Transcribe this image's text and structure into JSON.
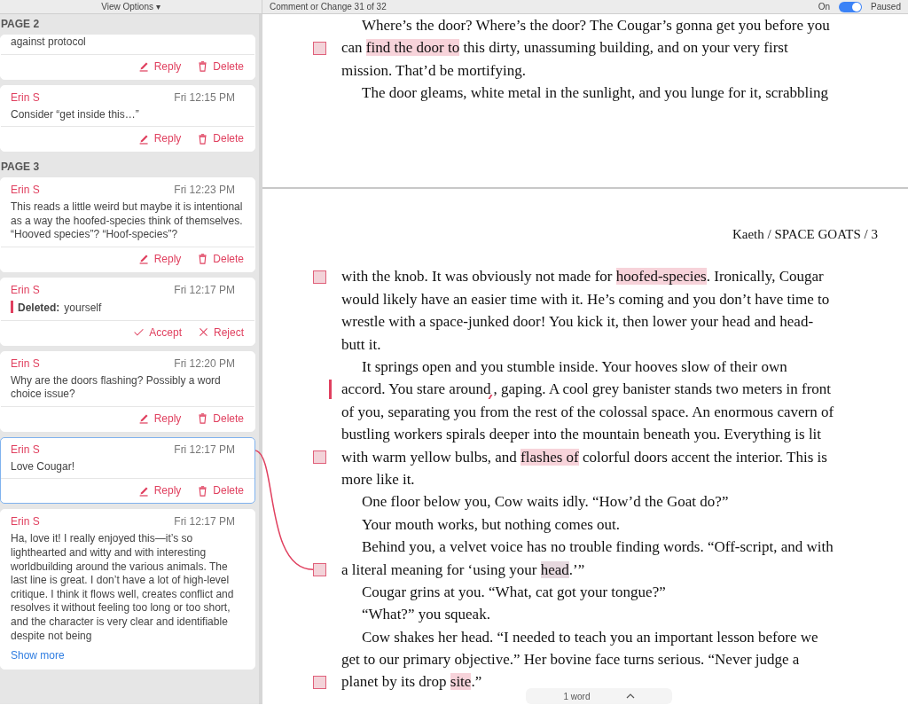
{
  "toolbar": {
    "view_options": "View Options ▾",
    "navigator": "Comment or Change 31 of 32",
    "tracking": {
      "label": "On",
      "on": true
    },
    "status": "Paused"
  },
  "sidebar": {
    "groups": [
      {
        "page": "PAGE 2",
        "cards": [
          {
            "kind": "partial",
            "body": "against protocol",
            "selected": false,
            "actions": [
              {
                "kind": "reply",
                "label": "Reply"
              },
              {
                "kind": "delete",
                "label": "Delete"
              }
            ]
          },
          {
            "kind": "comment",
            "author": "Erin S",
            "time": "Fri 12:15 PM",
            "body": "Consider “get inside this…”",
            "selected": false,
            "actions": [
              {
                "kind": "reply",
                "label": "Reply"
              },
              {
                "kind": "delete",
                "label": "Delete"
              }
            ]
          }
        ]
      },
      {
        "page": "PAGE 3",
        "cards": [
          {
            "kind": "comment",
            "author": "Erin S",
            "time": "Fri 12:23 PM",
            "body": "This reads a little weird but maybe it is intentional as a way the hoofed-species think of themselves. “Hooved species”? “Hoof-species”?",
            "selected": false,
            "actions": [
              {
                "kind": "reply",
                "label": "Reply"
              },
              {
                "kind": "delete",
                "label": "Delete"
              }
            ]
          },
          {
            "kind": "deletion",
            "author": "Erin S",
            "time": "Fri 12:17 PM",
            "change_label": "Deleted:",
            "body": "yourself",
            "selected": false,
            "actions": [
              {
                "kind": "accept",
                "label": "Accept"
              },
              {
                "kind": "reject",
                "label": "Reject"
              }
            ]
          },
          {
            "kind": "comment",
            "author": "Erin S",
            "time": "Fri 12:20 PM",
            "body": "Why are the doors flashing? Possibly a word choice issue?",
            "selected": false,
            "actions": [
              {
                "kind": "reply",
                "label": "Reply"
              },
              {
                "kind": "delete",
                "label": "Delete"
              }
            ]
          },
          {
            "kind": "comment",
            "author": "Erin S",
            "time": "Fri 12:17 PM",
            "body": "Love Cougar!",
            "selected": true,
            "actions": [
              {
                "kind": "reply",
                "label": "Reply"
              },
              {
                "kind": "delete",
                "label": "Delete"
              }
            ]
          },
          {
            "kind": "comment",
            "author": "Erin S",
            "time": "Fri 12:17 PM",
            "body": "Ha, love it! I really enjoyed this—it’s so lighthearted and witty and with interesting worldbuilding around the various animals. The last line is great. I don’t have a lot of high-level critique. I think it flows well, creates conflict and resolves it without feeling too long or too short, and the character is very clear and identifiable despite not being",
            "show_more": "Show more",
            "selected": false
          }
        ]
      }
    ]
  },
  "document": {
    "pages": [
      {
        "lines": [
          {
            "indent": true,
            "segments": [
              {
                "text": "Where’s the door? Where’s the door? The Cougar’s gonna get you before you"
              }
            ]
          },
          {
            "indent": false,
            "comment_marker": true,
            "segments": [
              {
                "text": "can "
              },
              {
                "text": "find the door to",
                "highlighted": true
              },
              {
                "text": " this dirty, unassuming building, and on your very first"
              }
            ]
          },
          {
            "indent": false,
            "segments": [
              {
                "text": "mission. That’d be mortifying."
              }
            ]
          },
          {
            "indent": true,
            "segments": [
              {
                "text": "The door gleams, white metal in the sunlight, and you lunge for it, scrabbling"
              }
            ]
          }
        ]
      },
      {
        "header": "Kaeth / SPACE GOATS / 3",
        "lines": [
          {
            "indent": false,
            "comment_marker": true,
            "segments": [
              {
                "text": "with the knob. It was obviously not made for "
              },
              {
                "text": "hoofed-species",
                "highlighted": true
              },
              {
                "text": ". Ironically, Cougar"
              }
            ]
          },
          {
            "indent": false,
            "segments": [
              {
                "text": "would likely have an easier time with it. He’s coming and you don’t have time to"
              }
            ]
          },
          {
            "indent": false,
            "segments": [
              {
                "text": "wrestle with a space-junked door! You kick it, then lower your head and head-"
              }
            ]
          },
          {
            "indent": false,
            "segments": [
              {
                "text": "butt it."
              }
            ]
          },
          {
            "indent": true,
            "segments": [
              {
                "text": "It springs open and you stumble inside. Your hooves slow of their own"
              }
            ]
          },
          {
            "indent": false,
            "change_bar": true,
            "segments": [
              {
                "text": "accord. You stare around",
                "deletion_after": true
              },
              {
                "text": ", gaping. A cool grey banister stands two meters in front"
              }
            ]
          },
          {
            "indent": false,
            "segments": [
              {
                "text": "of you, separating you from the rest of the colossal space. An enormous cavern of"
              }
            ]
          },
          {
            "indent": false,
            "segments": [
              {
                "text": "bustling workers spirals deeper into the mountain beneath you. Everything is lit"
              }
            ]
          },
          {
            "indent": false,
            "comment_marker": true,
            "segments": [
              {
                "text": "with warm yellow bulbs, and "
              },
              {
                "text": "flashes of",
                "highlighted": true
              },
              {
                "text": " colorful doors accent the interior. This is"
              }
            ]
          },
          {
            "indent": false,
            "segments": [
              {
                "text": "more like it."
              }
            ]
          },
          {
            "indent": true,
            "segments": [
              {
                "text": "One floor below you, Cow waits idly. “How’d the Goat do?”"
              }
            ]
          },
          {
            "indent": true,
            "segments": [
              {
                "text": "Your mouth works, but nothing comes out."
              }
            ]
          },
          {
            "indent": true,
            "segments": [
              {
                "text": "Behind you, a velvet voice has no trouble finding words. “Off-script, and with"
              }
            ]
          },
          {
            "indent": false,
            "comment_marker": true,
            "linked": true,
            "segments": [
              {
                "text": "a literal meaning for ‘using your "
              },
              {
                "text": "head",
                "highlighted": true,
                "active": true
              },
              {
                "text": ".’”"
              }
            ]
          },
          {
            "indent": true,
            "segments": [
              {
                "text": "Cougar grins at you. “What, cat got your tongue?”"
              }
            ]
          },
          {
            "indent": true,
            "segments": [
              {
                "text": "“What?” you squeak."
              }
            ]
          },
          {
            "indent": true,
            "segments": [
              {
                "text": "Cow shakes her head. “I needed to teach you an important lesson before we"
              }
            ]
          },
          {
            "indent": false,
            "segments": [
              {
                "text": "get to our primary objective.” Her bovine face turns serious. “Never judge a"
              }
            ]
          },
          {
            "indent": false,
            "comment_marker": true,
            "segments": [
              {
                "text": "planet by its drop "
              },
              {
                "text": "site",
                "highlighted": true
              },
              {
                "text": ".”"
              }
            ]
          }
        ]
      }
    ]
  },
  "word_count": "1 word"
}
